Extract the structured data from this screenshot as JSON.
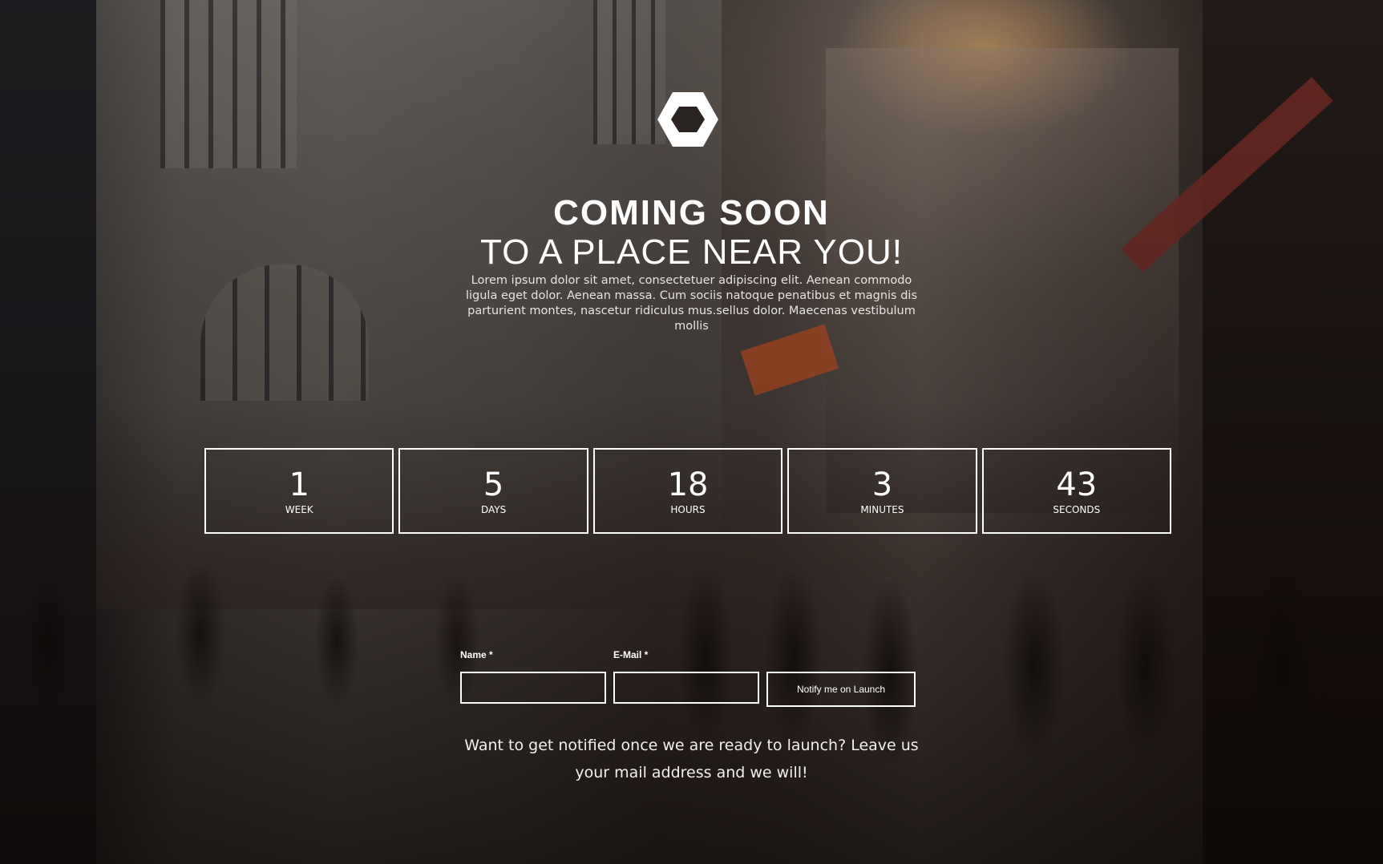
{
  "background": {
    "description_colors": {
      "overlay": "#000000",
      "sun_glow": "#ffbe6e"
    }
  },
  "logo": {
    "icon": "hexagon-logo-icon",
    "color": "#ffffff"
  },
  "hero": {
    "title_line1": "COMING SOON",
    "title_line2": "TO A PLACE NEAR YOU!",
    "lead": "Lorem ipsum dolor sit amet, consectetuer adipiscing elit. Aenean commodo ligula eget dolor. Aenean massa. Cum sociis natoque penatibus et magnis dis parturient montes, nascetur ridiculus mus.sellus dolor. Maecenas vestibulum mollis"
  },
  "countdown": {
    "items": [
      {
        "value": "1",
        "unit": "WEEK"
      },
      {
        "value": "5",
        "unit": "DAYS"
      },
      {
        "value": "18",
        "unit": "HOURS"
      },
      {
        "value": "3",
        "unit": "MINUTES"
      },
      {
        "value": "43",
        "unit": "SECONDS"
      }
    ]
  },
  "form": {
    "name_label": "Name *",
    "name_value": "",
    "email_label": "E-Mail *",
    "email_value": "",
    "submit_label": "Notify me on Launch"
  },
  "notice": "Want to get notified once we are ready to launch? Leave us your mail address and we will!"
}
